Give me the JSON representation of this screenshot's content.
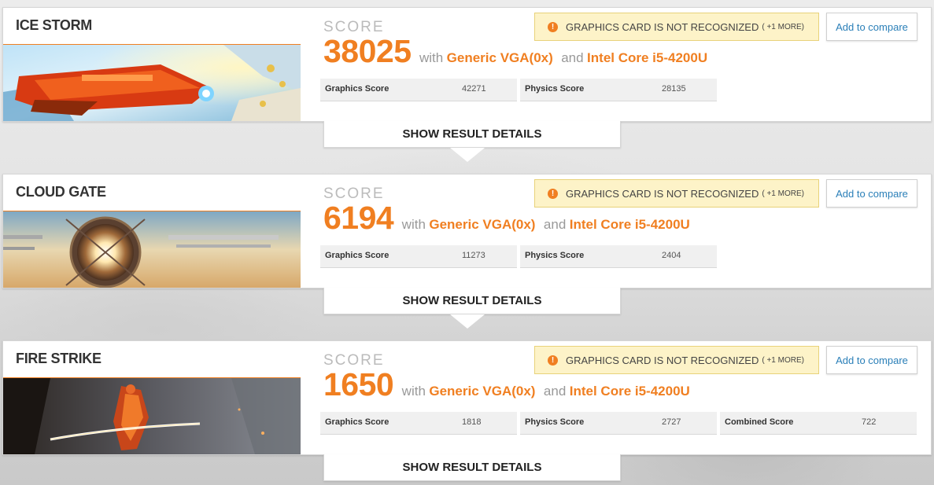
{
  "tests": [
    {
      "name": "ICE STORM",
      "score_label": "SCORE",
      "score": "38025",
      "with_text": "with",
      "gpu": "Generic VGA(0x)",
      "and_text": "and",
      "cpu": "Intel Core i5-4200U",
      "warning": "GRAPHICS CARD IS NOT RECOGNIZED",
      "warning_more": "( +1 MORE)",
      "compare_label": "Add to compare",
      "sub_scores": [
        {
          "label": "Graphics Score",
          "value": "42271"
        },
        {
          "label": "Physics Score",
          "value": "28135"
        }
      ],
      "details_label": "SHOW RESULT DETAILS"
    },
    {
      "name": "CLOUD GATE",
      "score_label": "SCORE",
      "score": "6194",
      "with_text": "with",
      "gpu": "Generic VGA(0x)",
      "and_text": "and",
      "cpu": "Intel Core i5-4200U",
      "warning": "GRAPHICS CARD IS NOT RECOGNIZED",
      "warning_more": "( +1 MORE)",
      "compare_label": "Add to compare",
      "sub_scores": [
        {
          "label": "Graphics Score",
          "value": "11273"
        },
        {
          "label": "Physics Score",
          "value": "2404"
        }
      ],
      "details_label": "SHOW RESULT DETAILS"
    },
    {
      "name": "FIRE STRIKE",
      "score_label": "SCORE",
      "score": "1650",
      "with_text": "with",
      "gpu": "Generic VGA(0x)",
      "and_text": "and",
      "cpu": "Intel Core i5-4200U",
      "warning": "GRAPHICS CARD IS NOT RECOGNIZED",
      "warning_more": "( +1 MORE)",
      "compare_label": "Add to compare",
      "sub_scores": [
        {
          "label": "Graphics Score",
          "value": "1818"
        },
        {
          "label": "Physics Score",
          "value": "2727"
        },
        {
          "label": "Combined Score",
          "value": "722"
        }
      ],
      "details_label": "SHOW RESULT DETAILS"
    }
  ],
  "colors": {
    "accent": "#f07f21",
    "warning_bg": "#fdf3c8",
    "link": "#2a7fb8"
  },
  "icons": {
    "warning": "warning-icon"
  }
}
